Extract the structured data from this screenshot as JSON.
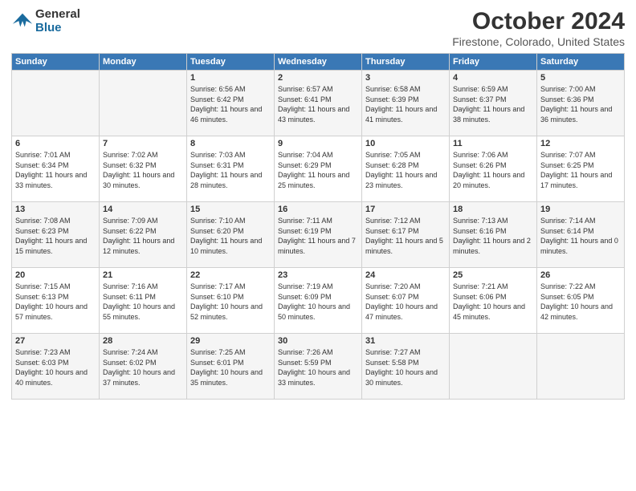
{
  "header": {
    "logo_line1": "General",
    "logo_line2": "Blue",
    "title": "October 2024",
    "subtitle": "Firestone, Colorado, United States"
  },
  "days_of_week": [
    "Sunday",
    "Monday",
    "Tuesday",
    "Wednesday",
    "Thursday",
    "Friday",
    "Saturday"
  ],
  "weeks": [
    [
      {
        "day": "",
        "sunrise": "",
        "sunset": "",
        "daylight": ""
      },
      {
        "day": "",
        "sunrise": "",
        "sunset": "",
        "daylight": ""
      },
      {
        "day": "1",
        "sunrise": "Sunrise: 6:56 AM",
        "sunset": "Sunset: 6:42 PM",
        "daylight": "Daylight: 11 hours and 46 minutes."
      },
      {
        "day": "2",
        "sunrise": "Sunrise: 6:57 AM",
        "sunset": "Sunset: 6:41 PM",
        "daylight": "Daylight: 11 hours and 43 minutes."
      },
      {
        "day": "3",
        "sunrise": "Sunrise: 6:58 AM",
        "sunset": "Sunset: 6:39 PM",
        "daylight": "Daylight: 11 hours and 41 minutes."
      },
      {
        "day": "4",
        "sunrise": "Sunrise: 6:59 AM",
        "sunset": "Sunset: 6:37 PM",
        "daylight": "Daylight: 11 hours and 38 minutes."
      },
      {
        "day": "5",
        "sunrise": "Sunrise: 7:00 AM",
        "sunset": "Sunset: 6:36 PM",
        "daylight": "Daylight: 11 hours and 36 minutes."
      }
    ],
    [
      {
        "day": "6",
        "sunrise": "Sunrise: 7:01 AM",
        "sunset": "Sunset: 6:34 PM",
        "daylight": "Daylight: 11 hours and 33 minutes."
      },
      {
        "day": "7",
        "sunrise": "Sunrise: 7:02 AM",
        "sunset": "Sunset: 6:32 PM",
        "daylight": "Daylight: 11 hours and 30 minutes."
      },
      {
        "day": "8",
        "sunrise": "Sunrise: 7:03 AM",
        "sunset": "Sunset: 6:31 PM",
        "daylight": "Daylight: 11 hours and 28 minutes."
      },
      {
        "day": "9",
        "sunrise": "Sunrise: 7:04 AM",
        "sunset": "Sunset: 6:29 PM",
        "daylight": "Daylight: 11 hours and 25 minutes."
      },
      {
        "day": "10",
        "sunrise": "Sunrise: 7:05 AM",
        "sunset": "Sunset: 6:28 PM",
        "daylight": "Daylight: 11 hours and 23 minutes."
      },
      {
        "day": "11",
        "sunrise": "Sunrise: 7:06 AM",
        "sunset": "Sunset: 6:26 PM",
        "daylight": "Daylight: 11 hours and 20 minutes."
      },
      {
        "day": "12",
        "sunrise": "Sunrise: 7:07 AM",
        "sunset": "Sunset: 6:25 PM",
        "daylight": "Daylight: 11 hours and 17 minutes."
      }
    ],
    [
      {
        "day": "13",
        "sunrise": "Sunrise: 7:08 AM",
        "sunset": "Sunset: 6:23 PM",
        "daylight": "Daylight: 11 hours and 15 minutes."
      },
      {
        "day": "14",
        "sunrise": "Sunrise: 7:09 AM",
        "sunset": "Sunset: 6:22 PM",
        "daylight": "Daylight: 11 hours and 12 minutes."
      },
      {
        "day": "15",
        "sunrise": "Sunrise: 7:10 AM",
        "sunset": "Sunset: 6:20 PM",
        "daylight": "Daylight: 11 hours and 10 minutes."
      },
      {
        "day": "16",
        "sunrise": "Sunrise: 7:11 AM",
        "sunset": "Sunset: 6:19 PM",
        "daylight": "Daylight: 11 hours and 7 minutes."
      },
      {
        "day": "17",
        "sunrise": "Sunrise: 7:12 AM",
        "sunset": "Sunset: 6:17 PM",
        "daylight": "Daylight: 11 hours and 5 minutes."
      },
      {
        "day": "18",
        "sunrise": "Sunrise: 7:13 AM",
        "sunset": "Sunset: 6:16 PM",
        "daylight": "Daylight: 11 hours and 2 minutes."
      },
      {
        "day": "19",
        "sunrise": "Sunrise: 7:14 AM",
        "sunset": "Sunset: 6:14 PM",
        "daylight": "Daylight: 11 hours and 0 minutes."
      }
    ],
    [
      {
        "day": "20",
        "sunrise": "Sunrise: 7:15 AM",
        "sunset": "Sunset: 6:13 PM",
        "daylight": "Daylight: 10 hours and 57 minutes."
      },
      {
        "day": "21",
        "sunrise": "Sunrise: 7:16 AM",
        "sunset": "Sunset: 6:11 PM",
        "daylight": "Daylight: 10 hours and 55 minutes."
      },
      {
        "day": "22",
        "sunrise": "Sunrise: 7:17 AM",
        "sunset": "Sunset: 6:10 PM",
        "daylight": "Daylight: 10 hours and 52 minutes."
      },
      {
        "day": "23",
        "sunrise": "Sunrise: 7:19 AM",
        "sunset": "Sunset: 6:09 PM",
        "daylight": "Daylight: 10 hours and 50 minutes."
      },
      {
        "day": "24",
        "sunrise": "Sunrise: 7:20 AM",
        "sunset": "Sunset: 6:07 PM",
        "daylight": "Daylight: 10 hours and 47 minutes."
      },
      {
        "day": "25",
        "sunrise": "Sunrise: 7:21 AM",
        "sunset": "Sunset: 6:06 PM",
        "daylight": "Daylight: 10 hours and 45 minutes."
      },
      {
        "day": "26",
        "sunrise": "Sunrise: 7:22 AM",
        "sunset": "Sunset: 6:05 PM",
        "daylight": "Daylight: 10 hours and 42 minutes."
      }
    ],
    [
      {
        "day": "27",
        "sunrise": "Sunrise: 7:23 AM",
        "sunset": "Sunset: 6:03 PM",
        "daylight": "Daylight: 10 hours and 40 minutes."
      },
      {
        "day": "28",
        "sunrise": "Sunrise: 7:24 AM",
        "sunset": "Sunset: 6:02 PM",
        "daylight": "Daylight: 10 hours and 37 minutes."
      },
      {
        "day": "29",
        "sunrise": "Sunrise: 7:25 AM",
        "sunset": "Sunset: 6:01 PM",
        "daylight": "Daylight: 10 hours and 35 minutes."
      },
      {
        "day": "30",
        "sunrise": "Sunrise: 7:26 AM",
        "sunset": "Sunset: 5:59 PM",
        "daylight": "Daylight: 10 hours and 33 minutes."
      },
      {
        "day": "31",
        "sunrise": "Sunrise: 7:27 AM",
        "sunset": "Sunset: 5:58 PM",
        "daylight": "Daylight: 10 hours and 30 minutes."
      },
      {
        "day": "",
        "sunrise": "",
        "sunset": "",
        "daylight": ""
      },
      {
        "day": "",
        "sunrise": "",
        "sunset": "",
        "daylight": ""
      }
    ]
  ]
}
